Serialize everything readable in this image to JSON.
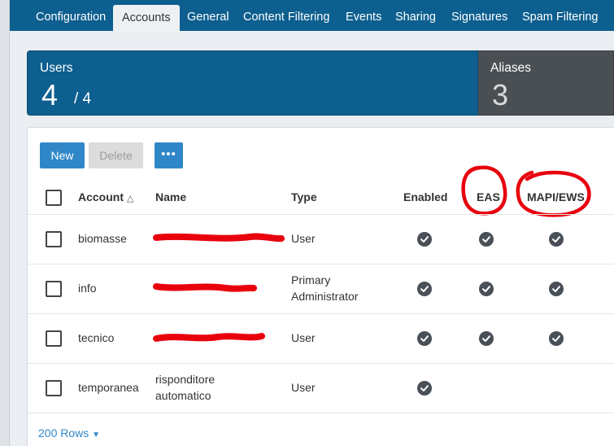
{
  "tabs": [
    {
      "label": "Configuration",
      "active": false
    },
    {
      "label": "Accounts",
      "active": true
    },
    {
      "label": "General",
      "active": false
    },
    {
      "label": "Content Filtering",
      "active": false
    },
    {
      "label": "Events",
      "active": false
    },
    {
      "label": "Sharing",
      "active": false
    },
    {
      "label": "Signatures",
      "active": false
    },
    {
      "label": "Spam Filtering",
      "active": false
    }
  ],
  "summary": {
    "users": {
      "label": "Users",
      "count": "4",
      "total": "/ 4"
    },
    "aliases": {
      "label": "Aliases",
      "count": "3"
    }
  },
  "toolbar": {
    "new_label": "New",
    "delete_label": "Delete",
    "more_label": "•••"
  },
  "table": {
    "headers": {
      "account": "Account",
      "name": "Name",
      "type": "Type",
      "enabled": "Enabled",
      "eas": "EAS",
      "mapi": "MAPI/EWS"
    },
    "rows": [
      {
        "account": "biomasse",
        "name": "",
        "type": "User",
        "enabled": true,
        "eas": true,
        "mapi": true
      },
      {
        "account": "info",
        "name": "",
        "type": "Primary Administrator",
        "enabled": true,
        "eas": true,
        "mapi": true
      },
      {
        "account": "tecnico",
        "name": "",
        "type": "User",
        "enabled": true,
        "eas": true,
        "mapi": true
      },
      {
        "account": "temporanea",
        "name": "risponditore automatico",
        "type": "User",
        "enabled": true,
        "eas": false,
        "mapi": false
      }
    ]
  },
  "footer": {
    "rows_label": "200 Rows"
  },
  "colors": {
    "brand": "#0d5f8f",
    "accent": "#2f87c8",
    "annotation": "#e8000d",
    "check": "#495057"
  }
}
